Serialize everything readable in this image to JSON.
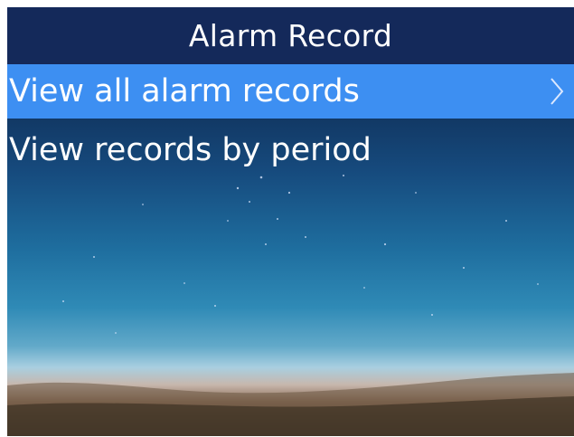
{
  "header": {
    "title": "Alarm Record"
  },
  "menu": {
    "items": [
      {
        "label": "View all alarm records",
        "selected": true,
        "icon": "chevron-right-icon"
      },
      {
        "label": "View records by period",
        "selected": false
      }
    ]
  },
  "colors": {
    "header_bg": "#14295a",
    "selected_bg": "#3d8ff2",
    "text": "#ffffff"
  }
}
